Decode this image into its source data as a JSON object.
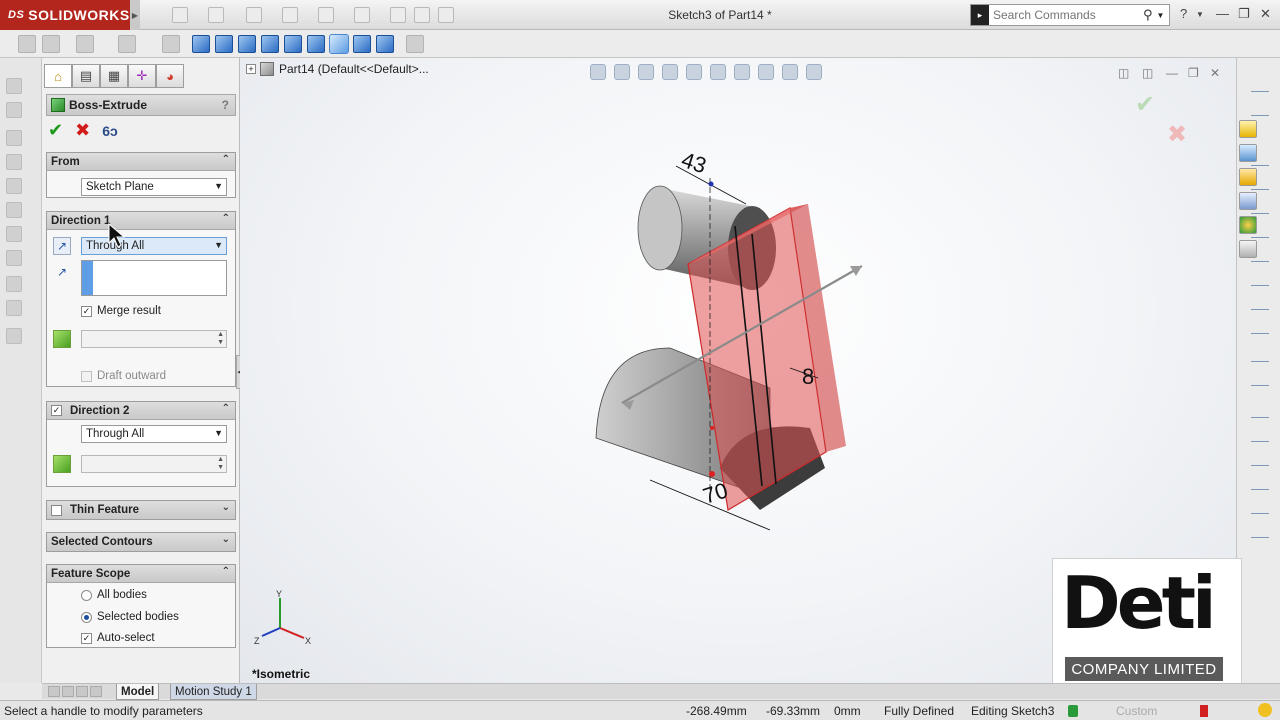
{
  "app": {
    "brand": "SOLIDWORKS",
    "brand_prefix": "DS",
    "window_title": "Sketch3 of Part14 *"
  },
  "search": {
    "placeholder": "Search Commands"
  },
  "property_manager": {
    "title": "Boss-Extrude",
    "help": "?",
    "from": {
      "label": "From",
      "value": "Sketch Plane"
    },
    "direction1": {
      "label": "Direction 1",
      "end_condition": "Through All",
      "merge_result": "Merge result",
      "draft_outward": "Draft outward"
    },
    "direction2": {
      "label": "Direction 2",
      "end_condition": "Through All",
      "checked": true
    },
    "thin_feature": {
      "label": "Thin Feature",
      "checked": false
    },
    "selected_contours": {
      "label": "Selected Contours"
    },
    "feature_scope": {
      "label": "Feature Scope",
      "all_bodies": "All bodies",
      "selected_bodies": "Selected bodies",
      "auto_select": "Auto-select"
    }
  },
  "viewport": {
    "breadcrumb": "Part14  (Default<<Default>...",
    "view_name": "*Isometric",
    "dimensions": {
      "top": "43",
      "right": "8",
      "bottom": "70"
    },
    "triad": {
      "x": "X",
      "y": "Y",
      "z": "Z"
    }
  },
  "bottom_tabs": {
    "model": "Model",
    "motion": "Motion Study 1"
  },
  "status": {
    "message": "Select a handle to modify parameters",
    "x": "-268.49mm",
    "y": "-69.33mm",
    "z": "0mm",
    "state": "Fully Defined",
    "mode": "Editing Sketch3",
    "units": "Custom"
  },
  "watermark": {
    "text": "Deti",
    "company": "COMPANY LIMITED"
  },
  "colors": {
    "brand": "#b3261e",
    "accent": "#2c6cc4",
    "extrude_preview": "#e05050",
    "ok": "#1e9a1e",
    "cancel": "#d11b1b"
  }
}
